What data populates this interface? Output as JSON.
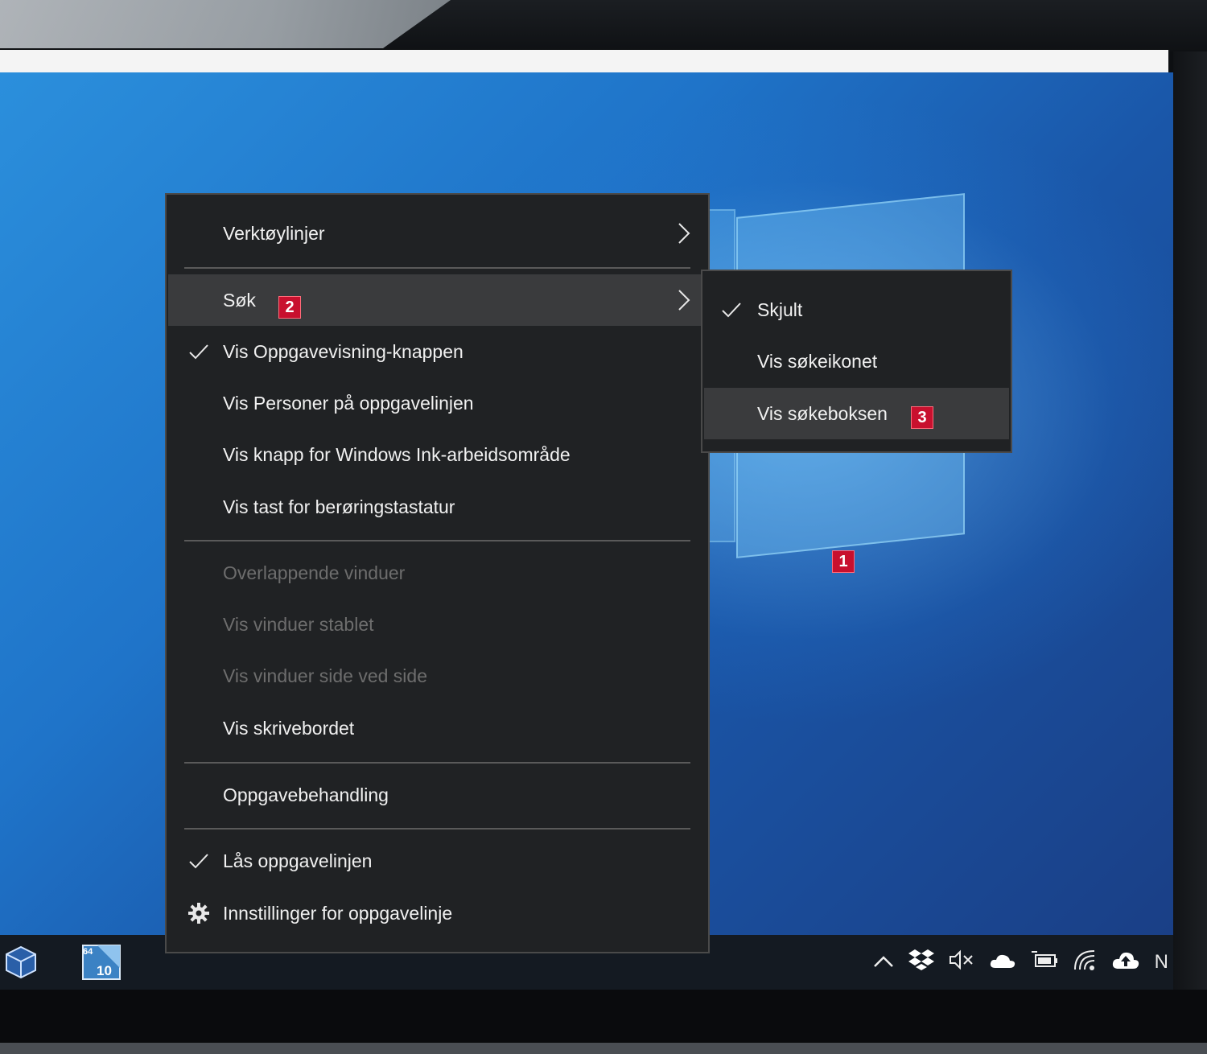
{
  "context_menu": {
    "items": [
      {
        "label": "Verktøylinjer"
      },
      {
        "label": "Søk"
      },
      {
        "label": "Vis Oppgavevisning-knappen"
      },
      {
        "label": "Vis Personer på oppgavelinjen"
      },
      {
        "label": "Vis knapp for Windows Ink-arbeidsområde"
      },
      {
        "label": "Vis tast for berøringstastatur"
      },
      {
        "label": "Overlappende vinduer"
      },
      {
        "label": "Vis vinduer stablet"
      },
      {
        "label": "Vis vinduer side ved side"
      },
      {
        "label": "Vis skrivebordet"
      },
      {
        "label": "Oppgavebehandling"
      },
      {
        "label": "Lås oppgavelinjen"
      },
      {
        "label": "Innstillinger for oppgavelinje"
      }
    ]
  },
  "search_submenu": {
    "items": [
      {
        "label": "Skjult"
      },
      {
        "label": "Vis søkeikonet"
      },
      {
        "label": "Vis søkeboksen"
      }
    ]
  },
  "callouts": {
    "one": "1",
    "two": "2",
    "three": "3"
  },
  "taskbar": {
    "app_badge_top": "64",
    "app_badge_bottom": "10",
    "tray_trailing_text": "N"
  },
  "colors": {
    "menu_background": "#202224",
    "menu_highlight": "#3a3b3d",
    "disabled_text": "#6d6d6d",
    "callout_red": "#c8102e",
    "desktop_blue": "#1f74c9"
  }
}
